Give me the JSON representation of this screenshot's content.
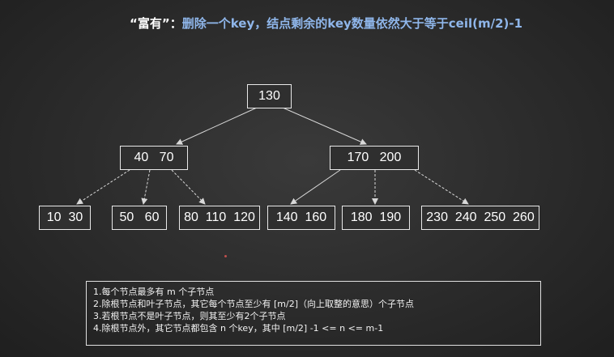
{
  "title": {
    "quote": "“富有”：",
    "text": "删除一个key，结点剩余的key数量依然大于等于ceil(m/2)-1"
  },
  "tree": {
    "root": "130",
    "level1": [
      "40   70",
      "170   200"
    ],
    "leaves": [
      "10  30",
      "50   60",
      "80  110  120",
      "140  160",
      "180  190",
      "230  240  250  260"
    ]
  },
  "rules": [
    "1.每个节点最多有 m 个子节点",
    "2.除根节点和叶子节点，其它每个节点至少有 [m/2]（向上取整的意思）个子节点",
    "3.若根节点不是叶子节点，则其至少有2个子节点",
    "4.除根节点外，其它节点都包含 n 个key，其中 [m/2] -1 <= n <= m-1"
  ],
  "colors": {
    "title": "#8fb6ea",
    "border": "#e8e8e8",
    "arrow": "#d8d8d8",
    "background": "#2b2b2b"
  }
}
